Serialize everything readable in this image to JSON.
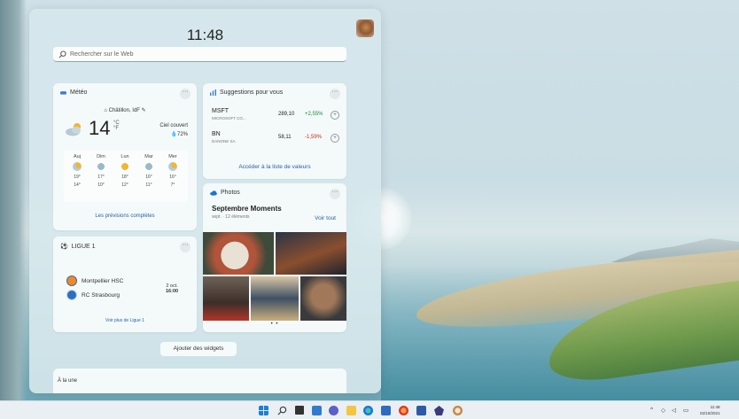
{
  "panel": {
    "time": "11:48",
    "search_placeholder": "Rechercher sur le Web"
  },
  "meteo": {
    "title": "Météo",
    "location": "Châtillon, IdF",
    "temperature": "14",
    "unit_c": "°C",
    "unit_f": "°F",
    "condition": "Ciel couvert",
    "humidity": "72%",
    "forecast": [
      {
        "day": "Auj",
        "hi": "19°",
        "lo": "14°",
        "icon": "partly-cloudy-icon"
      },
      {
        "day": "Dim",
        "hi": "17°",
        "lo": "10°",
        "icon": "rain-icon"
      },
      {
        "day": "Lun",
        "hi": "18°",
        "lo": "12°",
        "icon": "sun-icon"
      },
      {
        "day": "Mar",
        "hi": "16°",
        "lo": "11°",
        "icon": "rain-icon"
      },
      {
        "day": "Mer",
        "hi": "16°",
        "lo": "7°",
        "icon": "partly-cloudy-icon"
      }
    ],
    "link": "Les prévisions complètes"
  },
  "stocks": {
    "title": "Suggestions pour vous",
    "rows": [
      {
        "symbol": "MSFT",
        "name": "MICROSOFT CO...",
        "price": "289,10",
        "change": "+2,55%",
        "color": "#1a8a3a"
      },
      {
        "symbol": "BN",
        "name": "DANONE SA",
        "price": "58,11",
        "change": "-1,59%",
        "color": "#c42b1c"
      }
    ],
    "link": "Accéder à la liste de valeurs"
  },
  "ligue": {
    "title": "LIGUE 1",
    "teams": [
      "Montpellier HSC",
      "RC Strasbourg"
    ],
    "date": "2 oct.",
    "time": "16:00",
    "link": "Voir plus de Ligue 1"
  },
  "photos": {
    "title": "Photos",
    "album": "Septembre Moments",
    "subtitle": "sept. · 12 éléments",
    "see_all": "Voir tout",
    "dots": "• •"
  },
  "add_widgets": "Ajouter des widgets",
  "top_stories": "À la une",
  "taskbar": {
    "clock_time": "11:48",
    "clock_date": "02/10/2021",
    "tray_chevron": "^"
  }
}
